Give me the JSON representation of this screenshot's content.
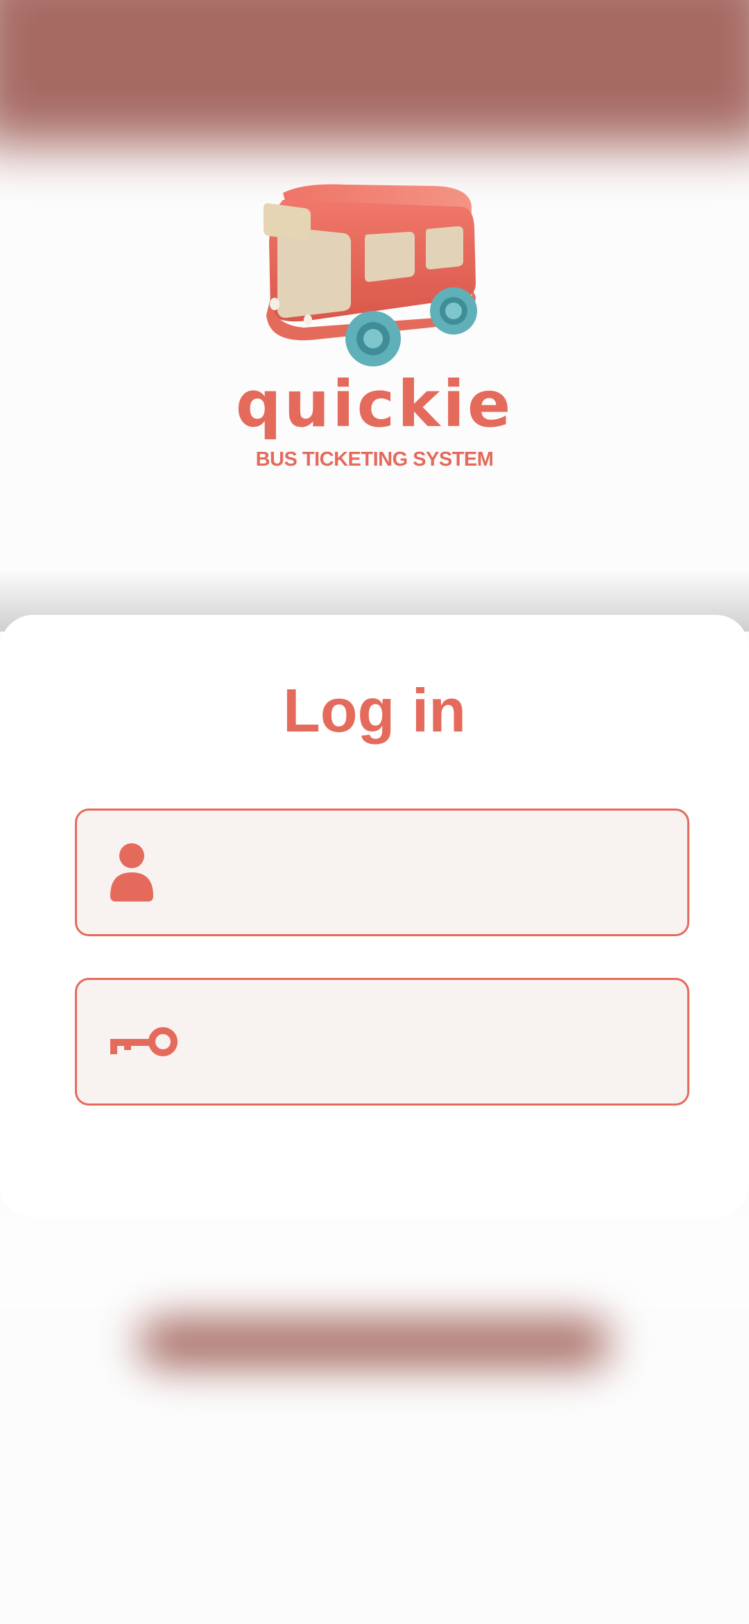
{
  "app": {
    "brand_name": "quickie",
    "tagline": "BUS TICKETING SYSTEM"
  },
  "login": {
    "title": "Log in",
    "username_field": {
      "value": "",
      "placeholder": "",
      "icon": "user-icon"
    },
    "password_field": {
      "value": "",
      "placeholder": "",
      "icon": "key-icon"
    }
  },
  "colors": {
    "accent": "#e46a5b",
    "field_background": "#f8f2f1",
    "header_shade": "#a66a63"
  }
}
